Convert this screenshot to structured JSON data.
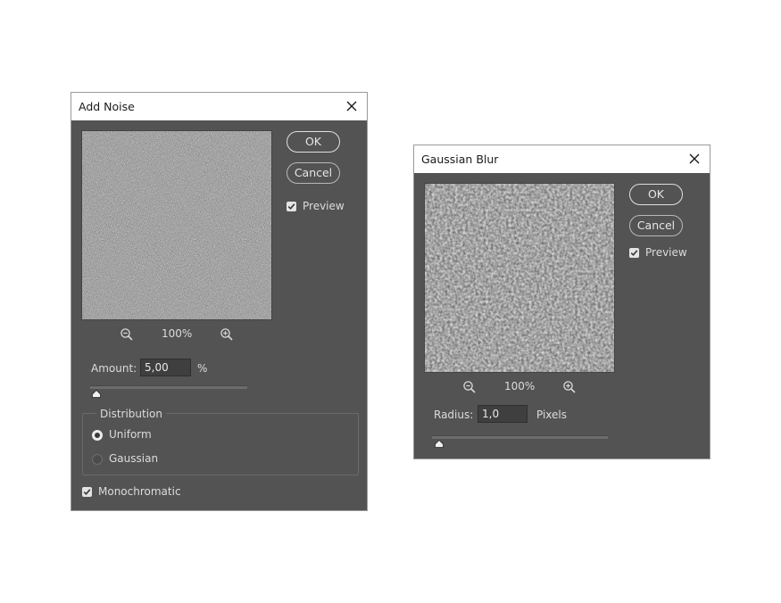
{
  "add_noise": {
    "title": "Add Noise",
    "ok_label": "OK",
    "cancel_label": "Cancel",
    "preview_label": "Preview",
    "preview_checked": true,
    "zoom_level": "100%",
    "amount_label": "Amount:",
    "amount_value": "5,00",
    "amount_unit": "%",
    "distribution_label": "Distribution",
    "distribution_options": [
      "Uniform",
      "Gaussian"
    ],
    "distribution_selected": "Uniform",
    "monochromatic_label": "Monochromatic",
    "monochromatic_checked": true
  },
  "gaussian_blur": {
    "title": "Gaussian Blur",
    "ok_label": "OK",
    "cancel_label": "Cancel",
    "preview_label": "Preview",
    "preview_checked": true,
    "zoom_level": "100%",
    "radius_label": "Radius:",
    "radius_value": "1,0",
    "radius_unit": "Pixels"
  },
  "icons": [
    "close-icon",
    "zoom-out-icon",
    "zoom-in-icon",
    "checkbox-check-icon",
    "slider-thumb-icon"
  ],
  "colors": {
    "dialog_bg": "#535353",
    "titlebar_bg": "#ffffff",
    "preview_bg": "#e6e6e6",
    "text": "#dcdcdc"
  }
}
